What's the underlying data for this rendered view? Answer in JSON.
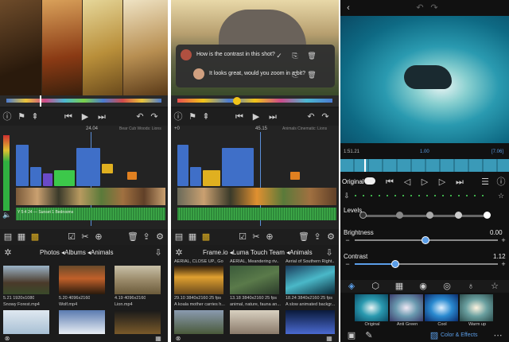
{
  "panel1": {
    "timecode_center": "24.04",
    "status_text": "Bear Cub Woods: Lions",
    "library": {
      "breadcrumb": "Photos ◂Albums ◂Animals",
      "items": [
        {
          "caption_top": "5.21  1920x1080",
          "caption_bottom": "Snowy Forest.mp4"
        },
        {
          "caption_top": "5.20  4096x2160",
          "caption_bottom": "Wolf.mp4"
        },
        {
          "caption_top": "4.19  4096x2160",
          "caption_bottom": "Lion.mp4"
        }
      ]
    },
    "clip_label": "Y 5:4 24 — Sunset 1 Bedrooms"
  },
  "panel2": {
    "comments": [
      {
        "text": "How is the contrast in this shot?"
      },
      {
        "text": "It looks great, would you zoom in a bit?"
      }
    ],
    "timecode_left": "+0",
    "timecode_center": "45.15",
    "status_text": "Animals Cinematic: Lions",
    "library": {
      "breadcrumb": "Frame.io ◂Luma Touch Team ◂Animals",
      "items": [
        {
          "title": "AERIAL, CLOSE UP., Gol...",
          "caption_top": "29.10  3840x2160  25 fps",
          "caption_bottom": "A koala mother carries h..."
        },
        {
          "title": "AERIAL, Meandering riv...",
          "caption_top": "13.18  3840x2160  25 fps",
          "caption_bottom": "animal, nature, fauna an..."
        },
        {
          "title": "Aerial of Southern Right...",
          "caption_top": "18.24  3840x2160  25 fps",
          "caption_bottom": "A slow animated backgr..."
        }
      ]
    }
  },
  "panel3": {
    "timecode_left": "1:51.21",
    "timecode_center": "1.00",
    "timecode_right": "[7.06]",
    "tab_label": "Original",
    "sliders": [
      {
        "label": "Levels",
        "value": ""
      },
      {
        "label": "Brightness",
        "value": "0.00"
      },
      {
        "label": "Contrast",
        "value": "1.12"
      }
    ],
    "presets": [
      "Original",
      "Anti Green",
      "Cool",
      "Warm up"
    ],
    "footer_label": "Color & Effects"
  },
  "colors": {
    "accent_blue": "#2f8ee8",
    "accent_yellow": "#f0c419",
    "panel_bg": "#1a1a1a"
  }
}
